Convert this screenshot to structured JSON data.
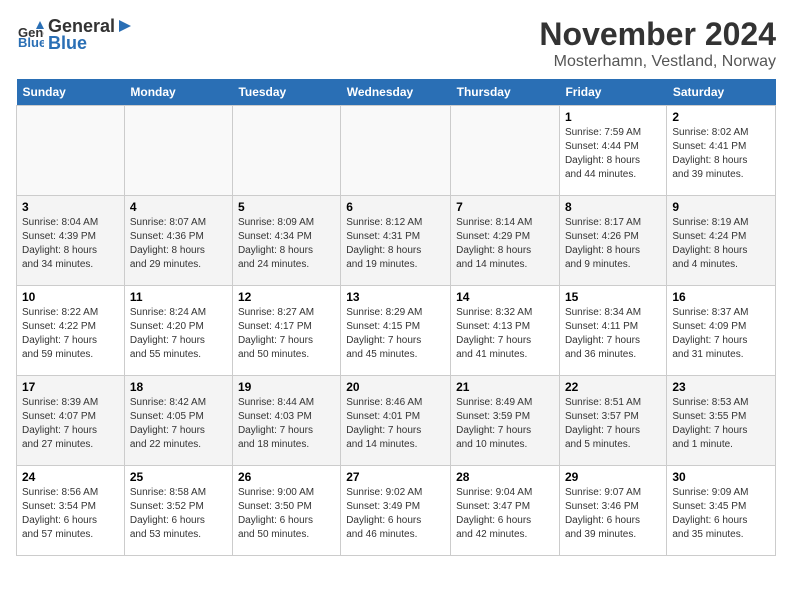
{
  "logo": {
    "general": "General",
    "blue": "Blue"
  },
  "title": "November 2024",
  "subtitle": "Mosterhamn, Vestland, Norway",
  "days_of_week": [
    "Sunday",
    "Monday",
    "Tuesday",
    "Wednesday",
    "Thursday",
    "Friday",
    "Saturday"
  ],
  "weeks": [
    [
      {
        "day": "",
        "info": ""
      },
      {
        "day": "",
        "info": ""
      },
      {
        "day": "",
        "info": ""
      },
      {
        "day": "",
        "info": ""
      },
      {
        "day": "",
        "info": ""
      },
      {
        "day": "1",
        "info": "Sunrise: 7:59 AM\nSunset: 4:44 PM\nDaylight: 8 hours\nand 44 minutes."
      },
      {
        "day": "2",
        "info": "Sunrise: 8:02 AM\nSunset: 4:41 PM\nDaylight: 8 hours\nand 39 minutes."
      }
    ],
    [
      {
        "day": "3",
        "info": "Sunrise: 8:04 AM\nSunset: 4:39 PM\nDaylight: 8 hours\nand 34 minutes."
      },
      {
        "day": "4",
        "info": "Sunrise: 8:07 AM\nSunset: 4:36 PM\nDaylight: 8 hours\nand 29 minutes."
      },
      {
        "day": "5",
        "info": "Sunrise: 8:09 AM\nSunset: 4:34 PM\nDaylight: 8 hours\nand 24 minutes."
      },
      {
        "day": "6",
        "info": "Sunrise: 8:12 AM\nSunset: 4:31 PM\nDaylight: 8 hours\nand 19 minutes."
      },
      {
        "day": "7",
        "info": "Sunrise: 8:14 AM\nSunset: 4:29 PM\nDaylight: 8 hours\nand 14 minutes."
      },
      {
        "day": "8",
        "info": "Sunrise: 8:17 AM\nSunset: 4:26 PM\nDaylight: 8 hours\nand 9 minutes."
      },
      {
        "day": "9",
        "info": "Sunrise: 8:19 AM\nSunset: 4:24 PM\nDaylight: 8 hours\nand 4 minutes."
      }
    ],
    [
      {
        "day": "10",
        "info": "Sunrise: 8:22 AM\nSunset: 4:22 PM\nDaylight: 7 hours\nand 59 minutes."
      },
      {
        "day": "11",
        "info": "Sunrise: 8:24 AM\nSunset: 4:20 PM\nDaylight: 7 hours\nand 55 minutes."
      },
      {
        "day": "12",
        "info": "Sunrise: 8:27 AM\nSunset: 4:17 PM\nDaylight: 7 hours\nand 50 minutes."
      },
      {
        "day": "13",
        "info": "Sunrise: 8:29 AM\nSunset: 4:15 PM\nDaylight: 7 hours\nand 45 minutes."
      },
      {
        "day": "14",
        "info": "Sunrise: 8:32 AM\nSunset: 4:13 PM\nDaylight: 7 hours\nand 41 minutes."
      },
      {
        "day": "15",
        "info": "Sunrise: 8:34 AM\nSunset: 4:11 PM\nDaylight: 7 hours\nand 36 minutes."
      },
      {
        "day": "16",
        "info": "Sunrise: 8:37 AM\nSunset: 4:09 PM\nDaylight: 7 hours\nand 31 minutes."
      }
    ],
    [
      {
        "day": "17",
        "info": "Sunrise: 8:39 AM\nSunset: 4:07 PM\nDaylight: 7 hours\nand 27 minutes."
      },
      {
        "day": "18",
        "info": "Sunrise: 8:42 AM\nSunset: 4:05 PM\nDaylight: 7 hours\nand 22 minutes."
      },
      {
        "day": "19",
        "info": "Sunrise: 8:44 AM\nSunset: 4:03 PM\nDaylight: 7 hours\nand 18 minutes."
      },
      {
        "day": "20",
        "info": "Sunrise: 8:46 AM\nSunset: 4:01 PM\nDaylight: 7 hours\nand 14 minutes."
      },
      {
        "day": "21",
        "info": "Sunrise: 8:49 AM\nSunset: 3:59 PM\nDaylight: 7 hours\nand 10 minutes."
      },
      {
        "day": "22",
        "info": "Sunrise: 8:51 AM\nSunset: 3:57 PM\nDaylight: 7 hours\nand 5 minutes."
      },
      {
        "day": "23",
        "info": "Sunrise: 8:53 AM\nSunset: 3:55 PM\nDaylight: 7 hours\nand 1 minute."
      }
    ],
    [
      {
        "day": "24",
        "info": "Sunrise: 8:56 AM\nSunset: 3:54 PM\nDaylight: 6 hours\nand 57 minutes."
      },
      {
        "day": "25",
        "info": "Sunrise: 8:58 AM\nSunset: 3:52 PM\nDaylight: 6 hours\nand 53 minutes."
      },
      {
        "day": "26",
        "info": "Sunrise: 9:00 AM\nSunset: 3:50 PM\nDaylight: 6 hours\nand 50 minutes."
      },
      {
        "day": "27",
        "info": "Sunrise: 9:02 AM\nSunset: 3:49 PM\nDaylight: 6 hours\nand 46 minutes."
      },
      {
        "day": "28",
        "info": "Sunrise: 9:04 AM\nSunset: 3:47 PM\nDaylight: 6 hours\nand 42 minutes."
      },
      {
        "day": "29",
        "info": "Sunrise: 9:07 AM\nSunset: 3:46 PM\nDaylight: 6 hours\nand 39 minutes."
      },
      {
        "day": "30",
        "info": "Sunrise: 9:09 AM\nSunset: 3:45 PM\nDaylight: 6 hours\nand 35 minutes."
      }
    ]
  ]
}
